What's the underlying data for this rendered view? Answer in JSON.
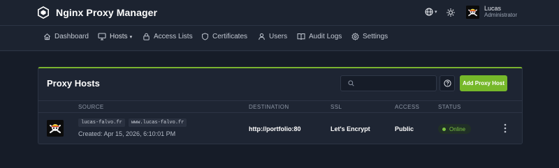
{
  "app": {
    "title": "Nginx Proxy Manager",
    "logo_icon": "hexagon-logo-icon"
  },
  "header": {
    "language_icon": "globe-icon",
    "theme_icon": "sun-icon",
    "user": {
      "name": "Lucas",
      "role": "Administrator",
      "avatar_icon": "skull-flag-avatar"
    }
  },
  "nav": {
    "items": [
      {
        "label": "Dashboard",
        "icon": "home-icon"
      },
      {
        "label": "Hosts",
        "icon": "monitor-icon",
        "dropdown": true
      },
      {
        "label": "Access Lists",
        "icon": "lock-icon"
      },
      {
        "label": "Certificates",
        "icon": "shield-icon"
      },
      {
        "label": "Users",
        "icon": "user-icon"
      },
      {
        "label": "Audit Logs",
        "icon": "book-icon"
      },
      {
        "label": "Settings",
        "icon": "gear-icon"
      }
    ]
  },
  "card": {
    "title": "Proxy Hosts",
    "search": {
      "placeholder": "",
      "value": ""
    },
    "help_icon": "help-circle-icon",
    "add_label": "Add Proxy Host",
    "accent_color": "#7ab32f"
  },
  "table": {
    "columns": [
      "SOURCE",
      "DESTINATION",
      "SSL",
      "ACCESS",
      "STATUS"
    ],
    "rows": [
      {
        "icon": "skull-flag-avatar",
        "domains": [
          "lucas-falvo.fr",
          "www.lucas-falvo.fr"
        ],
        "created": "Created: Apr 15, 2026, 6:10:01 PM",
        "destination": "http://portfolio:80",
        "ssl": "Let's Encrypt",
        "access": "Public",
        "status": "Online",
        "status_color": "#7cc241"
      }
    ]
  }
}
